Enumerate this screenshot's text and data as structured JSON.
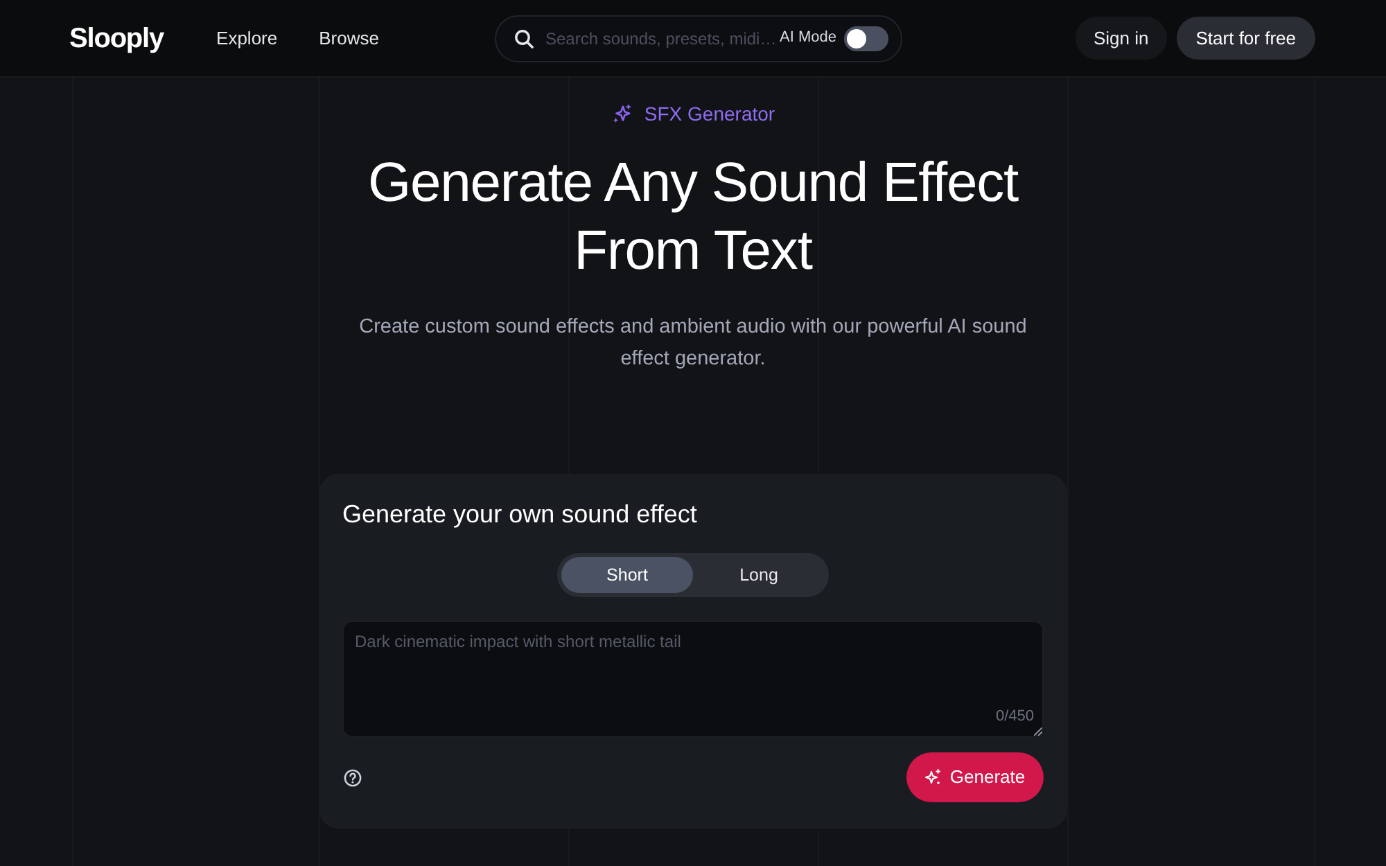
{
  "header": {
    "logo": "Slooply",
    "nav": [
      {
        "label": "Explore"
      },
      {
        "label": "Browse"
      }
    ],
    "search": {
      "placeholder": "Search sounds, presets, midi…"
    },
    "ai_mode": {
      "label": "AI Mode",
      "on": false
    },
    "buttons": [
      {
        "label": "Sign in",
        "kind": "ghost"
      },
      {
        "label": "Start for free",
        "kind": "filled"
      }
    ]
  },
  "hero": {
    "badge": "SFX Generator",
    "title": "Generate Any Sound Effect From Text",
    "subtitle": "Create custom sound effects and ambient audio with our powerful AI sound effect generator."
  },
  "generator": {
    "title": "Generate your own sound effect",
    "length_options": [
      {
        "label": "Short",
        "selected": true
      },
      {
        "label": "Long",
        "selected": false
      }
    ],
    "prompt": {
      "placeholder": "Dark cinematic impact with short metallic tail",
      "counter": "0/450"
    },
    "generate_button": "Generate"
  }
}
